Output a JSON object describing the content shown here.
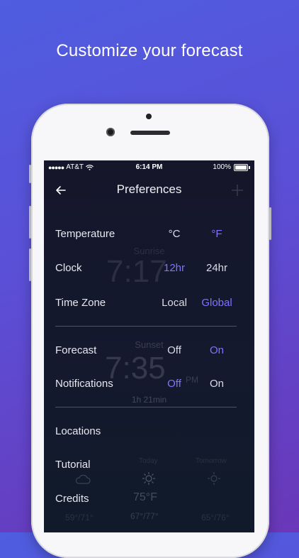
{
  "headline": {
    "text": "Customize your forecast"
  },
  "statusbar": {
    "carrier": "AT&T",
    "time": "6:14 PM",
    "battery": "100%"
  },
  "navbar": {
    "title": "Preferences"
  },
  "preferences": [
    {
      "label": "Temperature",
      "options": [
        "°C",
        "°F"
      ],
      "selected": 1
    },
    {
      "label": "Clock",
      "options": [
        "12hr",
        "24hr"
      ],
      "selected": 0
    },
    {
      "label": "Time Zone",
      "options": [
        "Local",
        "Global"
      ],
      "selected": 1
    },
    {
      "label": "Forecast",
      "options": [
        "Off",
        "On"
      ],
      "selected": 1
    },
    {
      "label": "Notifications",
      "options": [
        "Off",
        "On"
      ],
      "selected": 0
    }
  ],
  "links": [
    {
      "label": "Locations"
    },
    {
      "label": "Tutorial"
    },
    {
      "label": "Credits"
    }
  ],
  "background": {
    "sunrise_label": "Sunrise",
    "sunrise_time": "7:17",
    "sunset_label": "Sunset",
    "sunset_time": "7:35",
    "sunset_period": "PM",
    "day_length": "1h 21min",
    "today_label": "Today",
    "tomorrow_label": "Tomorrow",
    "today_temp": "75°F",
    "today_range": "67°/77°",
    "yesterday_range": "59°/71°",
    "tomorrow_range": "65°/76°"
  },
  "colors": {
    "accent": "#7f74ff"
  }
}
